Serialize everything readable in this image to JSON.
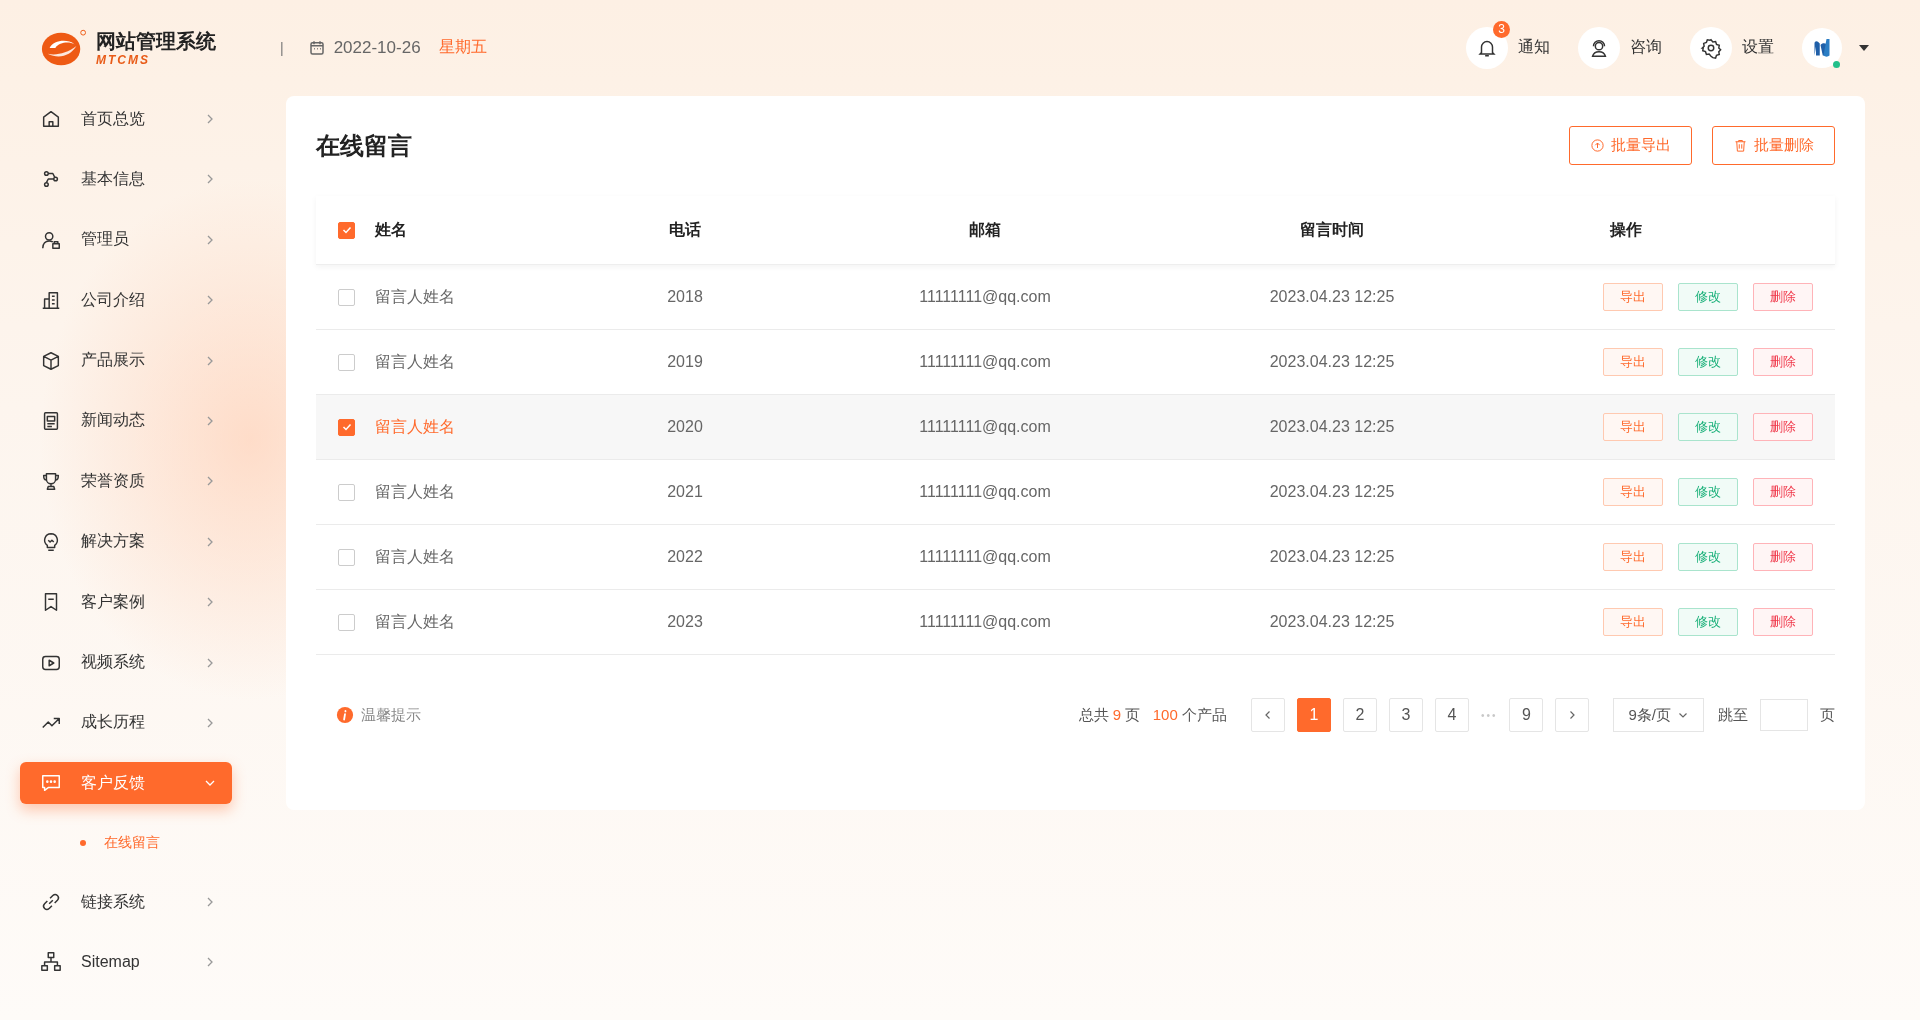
{
  "brand": {
    "title": "网站管理系统",
    "subtitle": "MTCMS"
  },
  "header": {
    "separator": "|",
    "date": "2022-10-26",
    "weekday": "星期五",
    "actions": [
      {
        "kind": "notify",
        "label": "通知",
        "badge": "3"
      },
      {
        "kind": "consult",
        "label": "咨询"
      },
      {
        "kind": "settings",
        "label": "设置"
      }
    ],
    "user": {
      "online": true
    }
  },
  "sidebar": {
    "items": [
      {
        "label": "首页总览",
        "selected": false,
        "expanded": false
      },
      {
        "label": "基本信息",
        "selected": false,
        "expanded": false
      },
      {
        "label": "管理员",
        "selected": false,
        "expanded": false
      },
      {
        "label": "公司介绍",
        "selected": false,
        "expanded": false
      },
      {
        "label": "产品展示",
        "selected": false,
        "expanded": false
      },
      {
        "label": "新闻动态",
        "selected": false,
        "expanded": false
      },
      {
        "label": "荣誉资质",
        "selected": false,
        "expanded": false
      },
      {
        "label": "解决方案",
        "selected": false,
        "expanded": false
      },
      {
        "label": "客户案例",
        "selected": false,
        "expanded": false
      },
      {
        "label": "视频系统",
        "selected": false,
        "expanded": false
      },
      {
        "label": "成长历程",
        "selected": false,
        "expanded": false
      },
      {
        "label": "客户反馈",
        "selected": true,
        "expanded": true,
        "children": [
          {
            "label": "在线留言",
            "selected": true
          }
        ]
      },
      {
        "label": "链接系统",
        "selected": false,
        "expanded": false
      },
      {
        "label": "Sitemap",
        "selected": false,
        "expanded": false
      }
    ]
  },
  "page": {
    "title": "在线留言",
    "buttons": [
      {
        "kind": "export",
        "label": "批量导出"
      },
      {
        "kind": "delete",
        "label": "批量删除"
      }
    ]
  },
  "table": {
    "columns": [
      "姓名",
      "电话",
      "邮箱",
      "留言时间",
      "操作"
    ],
    "all_checked": true,
    "rows": [
      {
        "name": "留言人姓名",
        "phone": "2018",
        "email": "11111111@qq.com",
        "time": "2023.04.23 12:25",
        "checked": false,
        "selected": false,
        "actions": [
          {
            "kind": "export",
            "label": "导出"
          },
          {
            "kind": "edit",
            "label": "修改"
          },
          {
            "kind": "delete",
            "label": "删除"
          }
        ]
      },
      {
        "name": "留言人姓名",
        "phone": "2019",
        "email": "11111111@qq.com",
        "time": "2023.04.23 12:25",
        "checked": false,
        "selected": false,
        "actions": [
          {
            "kind": "export",
            "label": "导出"
          },
          {
            "kind": "edit",
            "label": "修改"
          },
          {
            "kind": "delete",
            "label": "删除"
          }
        ]
      },
      {
        "name": "留言人姓名",
        "phone": "2020",
        "email": "11111111@qq.com",
        "time": "2023.04.23 12:25",
        "checked": true,
        "selected": true,
        "actions": [
          {
            "kind": "export",
            "label": "导出"
          },
          {
            "kind": "edit",
            "label": "修改"
          },
          {
            "kind": "delete",
            "label": "删除"
          }
        ]
      },
      {
        "name": "留言人姓名",
        "phone": "2021",
        "email": "11111111@qq.com",
        "time": "2023.04.23 12:25",
        "checked": false,
        "selected": false,
        "actions": [
          {
            "kind": "export",
            "label": "导出"
          },
          {
            "kind": "edit",
            "label": "修改"
          },
          {
            "kind": "delete",
            "label": "删除"
          }
        ]
      },
      {
        "name": "留言人姓名",
        "phone": "2022",
        "email": "11111111@qq.com",
        "time": "2023.04.23 12:25",
        "checked": false,
        "selected": false,
        "actions": [
          {
            "kind": "export",
            "label": "导出"
          },
          {
            "kind": "edit",
            "label": "修改"
          },
          {
            "kind": "delete",
            "label": "删除"
          }
        ]
      },
      {
        "name": "留言人姓名",
        "phone": "2023",
        "email": "11111111@qq.com",
        "time": "2023.04.23 12:25",
        "checked": false,
        "selected": false,
        "actions": [
          {
            "kind": "export",
            "label": "导出"
          },
          {
            "kind": "edit",
            "label": "修改"
          },
          {
            "kind": "delete",
            "label": "删除"
          }
        ]
      }
    ]
  },
  "footer": {
    "hint": "温馨提示",
    "total_prefix": "总共",
    "pages_total": "9",
    "pages_unit": "页",
    "count": "100",
    "count_unit": "个产品",
    "pages": [
      {
        "kind": "page",
        "label": "1",
        "selected": true
      },
      {
        "kind": "page",
        "label": "2",
        "selected": false
      },
      {
        "kind": "page",
        "label": "3",
        "selected": false
      },
      {
        "kind": "page",
        "label": "4",
        "selected": false
      },
      {
        "kind": "ellipsis",
        "label": "•••"
      },
      {
        "kind": "page",
        "label": "9",
        "selected": false
      }
    ],
    "page_size": "9条/页",
    "jump_label": "跳至",
    "jump_unit": "页"
  }
}
